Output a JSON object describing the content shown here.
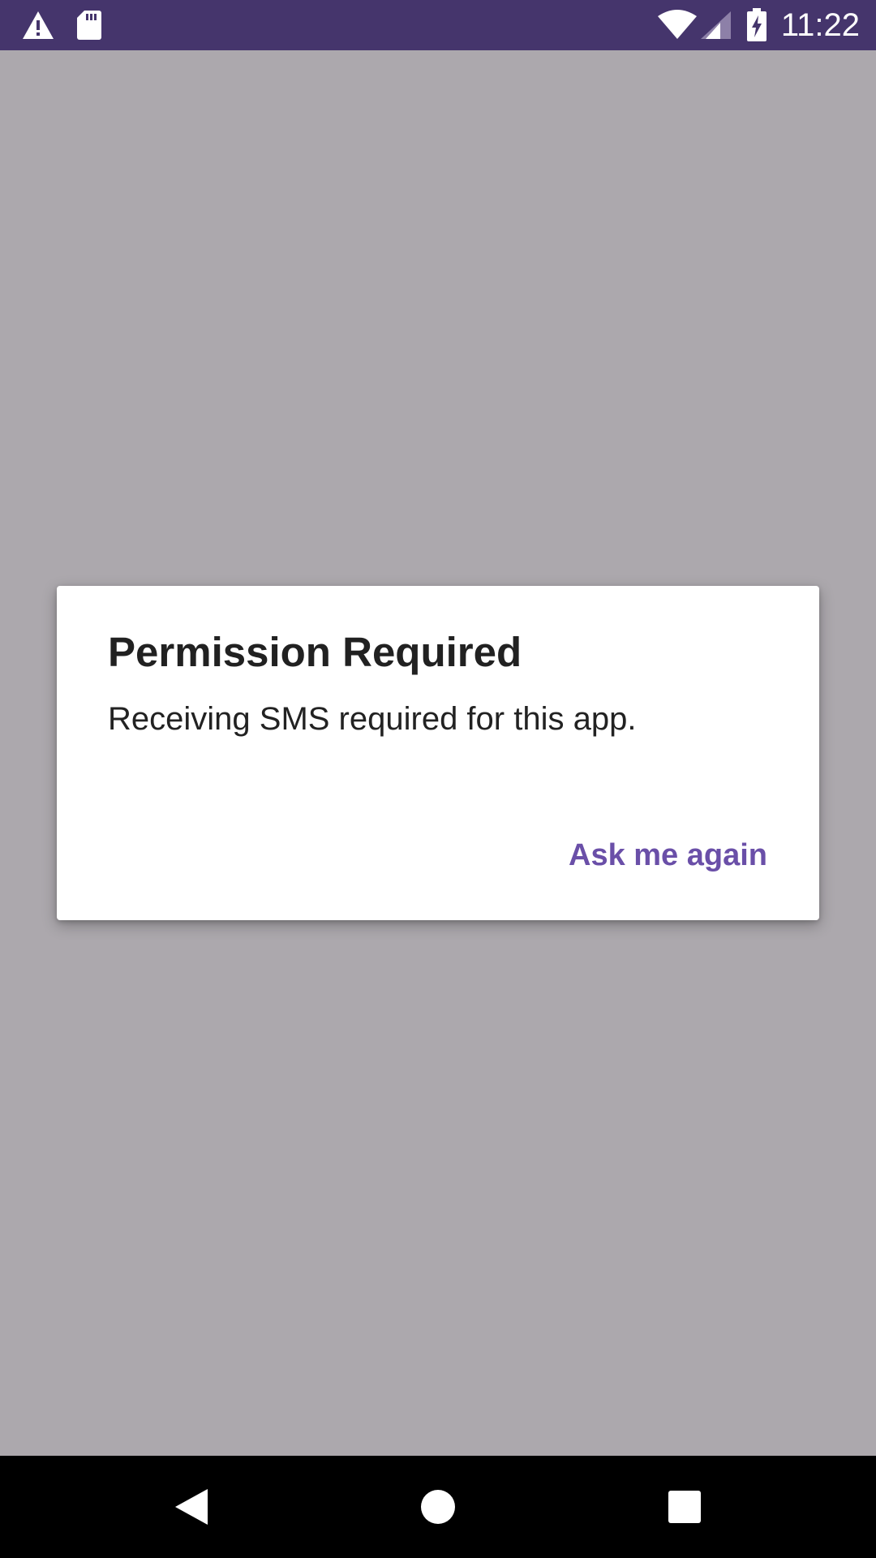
{
  "status_bar": {
    "time": "11:22",
    "background_color": "#45356c",
    "icons": [
      "warning-icon",
      "sd-card-icon",
      "wifi-icon",
      "signal-icon",
      "battery-charging-icon"
    ]
  },
  "dialog": {
    "title": "Permission Required",
    "message": "Receiving SMS required for this app.",
    "button_label": "Ask me again",
    "accent_color": "#6a4fa8"
  },
  "background_color": "#aca8ad",
  "nav_bar": {
    "buttons": [
      "back-icon",
      "home-icon",
      "recents-icon"
    ]
  }
}
